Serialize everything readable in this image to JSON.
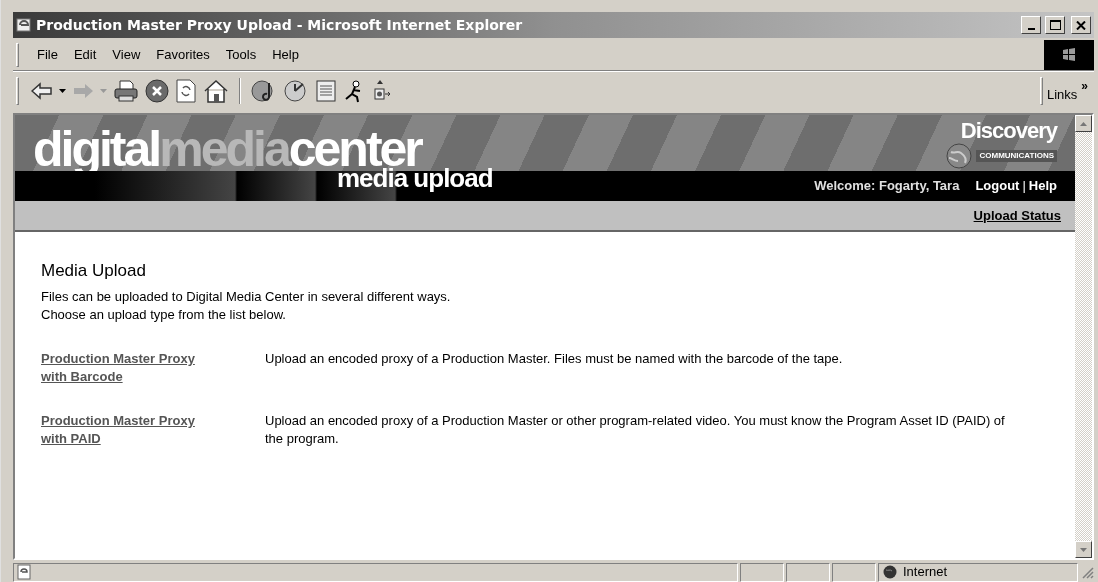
{
  "window": {
    "title": "Production Master Proxy Upload - Microsoft Internet Explorer"
  },
  "menu": [
    "File",
    "Edit",
    "View",
    "Favorites",
    "Tools",
    "Help"
  ],
  "links_label": "Links",
  "links_chevron": "»",
  "banner": {
    "logo_parts": [
      "digital",
      "media",
      "center"
    ],
    "subtitle": "media upload",
    "brand": "Discovery",
    "brand_sub": "COMMUNICATIONS",
    "welcome": "Welcome: Fogarty, Tara",
    "logout": "Logout",
    "separator": "|",
    "help": "Help",
    "upload_status": "Upload Status"
  },
  "page": {
    "heading": "Media Upload",
    "intro": [
      "Files can be uploaded to Digital Media Center in several different ways.",
      "Choose an upload type from the list below."
    ],
    "options": [
      {
        "link": "Production Master Proxy with Barcode",
        "description": "Upload an encoded proxy of a Production Master. Files must be named with the barcode of the tape."
      },
      {
        "link": "Production Master Proxy with PAID",
        "description": "Upload an encoded proxy of a Production Master or other program-related video. You must know the Program Asset ID (PAID) of the program."
      }
    ]
  },
  "status_bar": {
    "zone": "Internet"
  }
}
